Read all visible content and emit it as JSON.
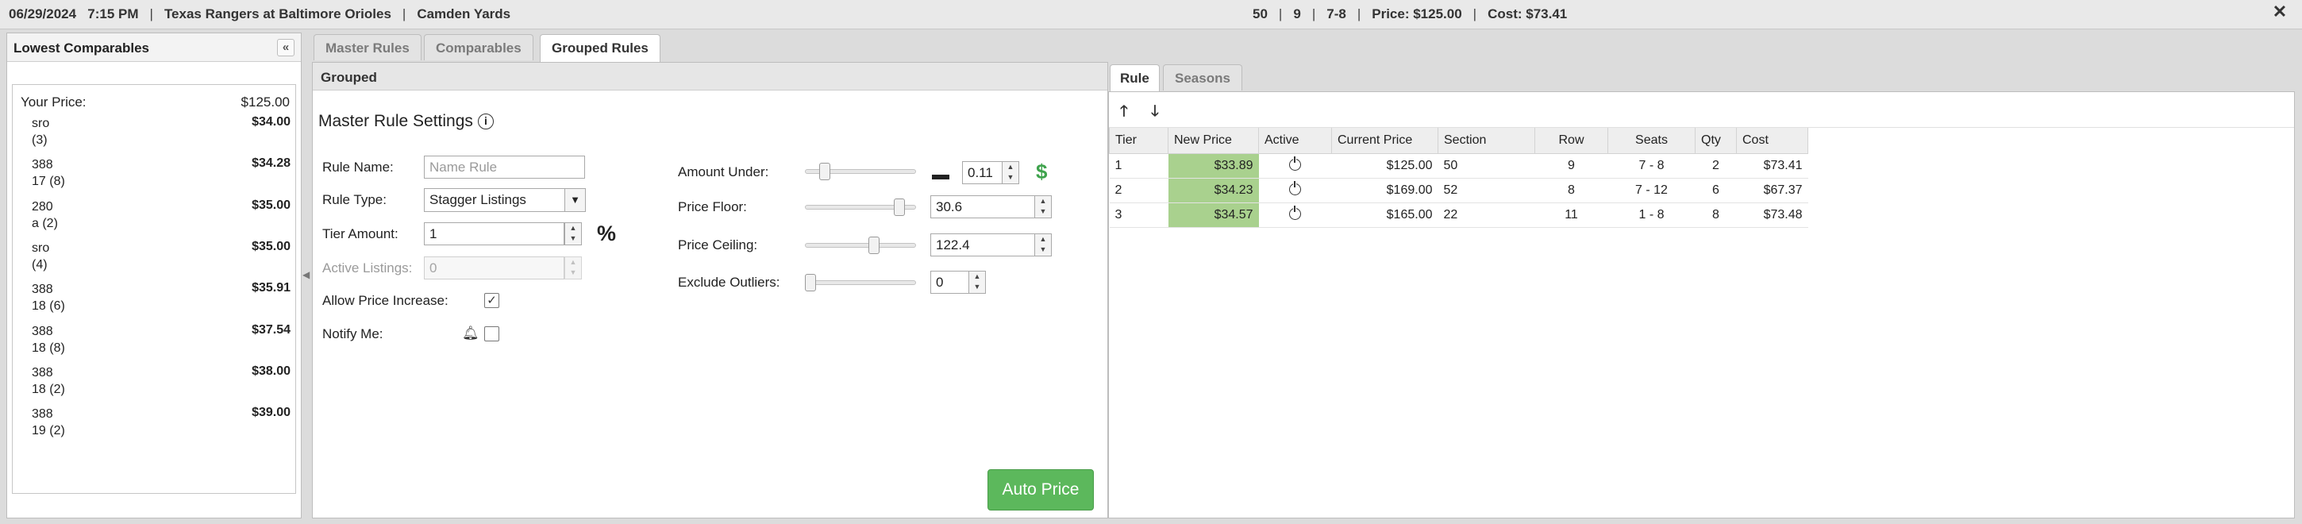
{
  "topbar": {
    "date": "06/29/2024",
    "time": "7:15 PM",
    "event": "Texas Rangers at Baltimore Orioles",
    "venue": "Camden Yards",
    "stat1": "50",
    "stat2": "9",
    "stat3": "7-8",
    "price": "Price: $125.00",
    "cost": "Cost: $73.41",
    "separator": "|",
    "close_label": "✕"
  },
  "left_panel": {
    "title": "Lowest Comparables",
    "collapse_label": "«",
    "your_price_label": "Your Price:",
    "your_price_value": "$125.00",
    "comparables": [
      {
        "line1": "sro",
        "line2": "(3)",
        "price": "$34.00"
      },
      {
        "line1": "388",
        "line2": "17 (8)",
        "price": "$34.28"
      },
      {
        "line1": "280",
        "line2": "a (2)",
        "price": "$35.00"
      },
      {
        "line1": "sro",
        "line2": "(4)",
        "price": "$35.00"
      },
      {
        "line1": "388",
        "line2": "18 (6)",
        "price": "$35.91"
      },
      {
        "line1": "388",
        "line2": "18 (8)",
        "price": "$37.54"
      },
      {
        "line1": "388",
        "line2": "18 (2)",
        "price": "$38.00"
      },
      {
        "line1": "388",
        "line2": "19 (2)",
        "price": "$39.00"
      }
    ]
  },
  "tabs": [
    "Master Rules",
    "Comparables",
    "Grouped Rules"
  ],
  "grouped": {
    "header": "Grouped",
    "section_title": "Master Rule Settings",
    "info_icon": "i",
    "rule_name_label": "Rule Name:",
    "rule_name_placeholder": "Name Rule",
    "rule_type_label": "Rule Type:",
    "rule_type_value": "Stagger Listings",
    "tier_amount_label": "Tier Amount:",
    "tier_amount_value": "1",
    "tier_amount_unit": "%",
    "active_listings_label": "Active Listings:",
    "active_listings_value": "0",
    "allow_increase_label": "Allow Price Increase:",
    "allow_increase_checked": true,
    "notify_label": "Notify Me:",
    "notify_checked": false,
    "amount_under_label": "Amount Under:",
    "amount_under_value": "0.11",
    "amount_under_unit": "$",
    "price_floor_label": "Price Floor:",
    "price_floor_value": "30.6",
    "price_ceiling_label": "Price Ceiling:",
    "price_ceiling_value": "122.4",
    "exclude_outliers_label": "Exclude Outliers:",
    "exclude_outliers_value": "0",
    "auto_price_label": "Auto Price"
  },
  "right_tabs": [
    "Rule",
    "Seasons"
  ],
  "toolbar": {
    "up_icon": "🡑",
    "down_icon": "🡓"
  },
  "table": {
    "columns": [
      "Tier",
      "New Price",
      "Active",
      "Current Price",
      "Section",
      "Row",
      "Seats",
      "Qty",
      "Cost"
    ],
    "rows": [
      {
        "tier": "1",
        "new_price": "$33.89",
        "current_price": "$125.00",
        "section": "50",
        "row": "9",
        "seats": "7 - 8",
        "qty": "2",
        "cost": "$73.41"
      },
      {
        "tier": "2",
        "new_price": "$34.23",
        "current_price": "$169.00",
        "section": "52",
        "row": "8",
        "seats": "7 - 12",
        "qty": "6",
        "cost": "$67.37"
      },
      {
        "tier": "3",
        "new_price": "$34.57",
        "current_price": "$165.00",
        "section": "22",
        "row": "11",
        "seats": "1 - 8",
        "qty": "8",
        "cost": "$73.48"
      }
    ]
  },
  "colors": {
    "new_price_bg": "#a9d18e",
    "auto_price_bg": "#5cb85c",
    "dollar_icon": "#3fa34d"
  }
}
